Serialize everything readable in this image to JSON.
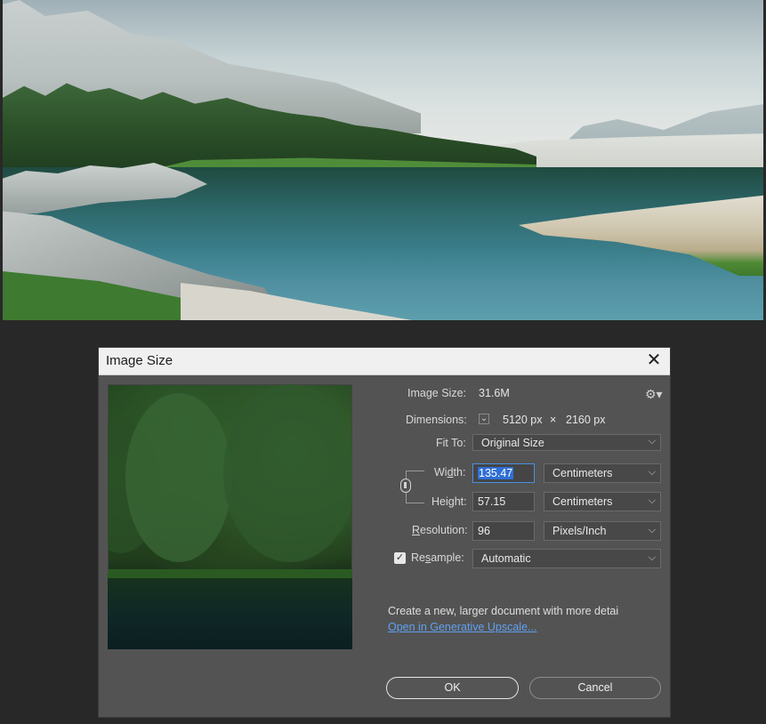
{
  "dialog": {
    "title": "Image Size",
    "close_glyph": "✕",
    "image_size": {
      "label": "Image Size:",
      "value": "31.6M"
    },
    "dimensions": {
      "label": "Dimensions:",
      "width_px": "5120 px",
      "times": "×",
      "height_px": "2160 px"
    },
    "fit_to": {
      "label": "Fit To:",
      "value": "Original Size"
    },
    "width": {
      "label_pre": "Wi",
      "label_u": "d",
      "label_post": "th:",
      "value": "135.47",
      "unit": "Centimeters"
    },
    "height": {
      "label_pre": "Hei",
      "label_u": "g",
      "label_post": "ht:",
      "value": "57.15",
      "unit": "Centimeters"
    },
    "resolution": {
      "label_u": "R",
      "label_post": "esolution:",
      "value": "96",
      "unit": "Pixels/Inch"
    },
    "resample": {
      "label_pre": "Re",
      "label_u": "s",
      "label_post": "ample:",
      "checked": true,
      "value": "Automatic"
    },
    "info_text": "Create a new, larger document with more detai",
    "link_text": "Open in Generative Upscale...",
    "ok_label": "OK",
    "cancel_label": "Cancel",
    "icons": {
      "gear": "gear-icon",
      "chevron": "chevron-down-icon",
      "link": "chain-link-icon",
      "check": "checkmark-icon"
    },
    "accent_color": "#2f6fd6",
    "link_color": "#5fa1f0"
  }
}
